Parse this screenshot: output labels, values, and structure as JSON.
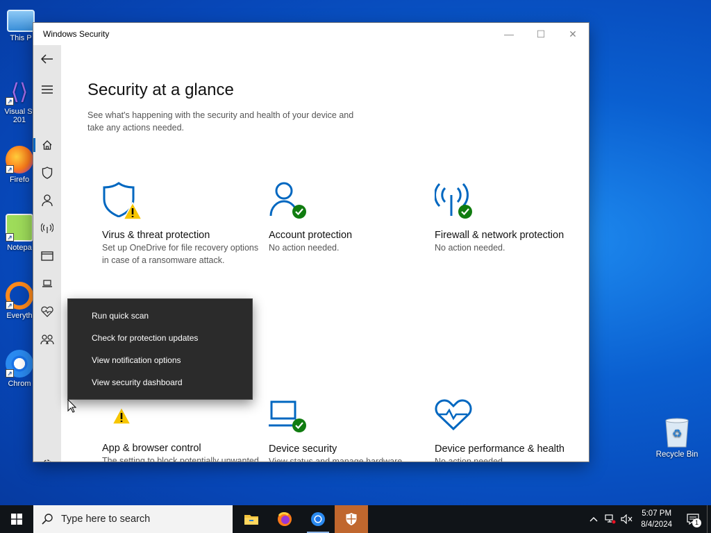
{
  "desktop": {
    "icons": [
      {
        "label": "This P",
        "icon": "computer-icon"
      },
      {
        "label": "Visual St\n201",
        "icon": "visual-studio-icon"
      },
      {
        "label": "Firefo",
        "icon": "firefox-icon"
      },
      {
        "label": "Notepa",
        "icon": "notepad-plus-icon"
      },
      {
        "label": "Everyth",
        "icon": "everything-search-icon"
      },
      {
        "label": "Chrom",
        "icon": "chrome-icon"
      }
    ],
    "recycle_bin": "Recycle Bin"
  },
  "window": {
    "title": "Windows Security",
    "controls": {
      "minimize": "—",
      "maximize": "☐",
      "close": "✕"
    }
  },
  "sidebar": {
    "items": [
      "back",
      "menu",
      "home",
      "virus-protection",
      "account",
      "firewall",
      "app-browser",
      "device-security",
      "device-performance",
      "family-options",
      "settings"
    ]
  },
  "main": {
    "title": "Security at a glance",
    "description": "See what's happening with the security and health of your device and take any actions needed.",
    "cards": [
      {
        "title": "Virus & threat protection",
        "desc": "Set up OneDrive for file recovery options in case of a ransomware attack.",
        "status": "warning"
      },
      {
        "title": "Account protection",
        "desc": "No action needed.",
        "status": "ok"
      },
      {
        "title": "Firewall & network protection",
        "desc": "No action needed.",
        "status": "ok"
      },
      {
        "title": "App & browser control",
        "desc": "The setting to block potentially unwanted apps is turned off.",
        "status": "warning"
      },
      {
        "title": "Device security",
        "desc": "View status and manage hardware security features",
        "status": "ok"
      },
      {
        "title": "Device performance & health",
        "desc": "No action needed.",
        "status": "ok"
      }
    ]
  },
  "context_menu": {
    "items": [
      "Run quick scan",
      "Check for protection updates",
      "View notification options",
      "View security dashboard"
    ]
  },
  "taskbar": {
    "search_placeholder": "Type here to search",
    "apps": [
      "file-explorer-icon",
      "firefox-icon",
      "chrome-icon",
      "windows-security-icon"
    ],
    "time": "5:07 PM",
    "date": "8/4/2024",
    "notification_count": "1"
  },
  "colors": {
    "accent": "#0067c0",
    "ok_green": "#107c10",
    "warning_yellow": "#f7c600",
    "menu_bg": "#2b2b2b",
    "taskbar_active": "#c0672e"
  }
}
